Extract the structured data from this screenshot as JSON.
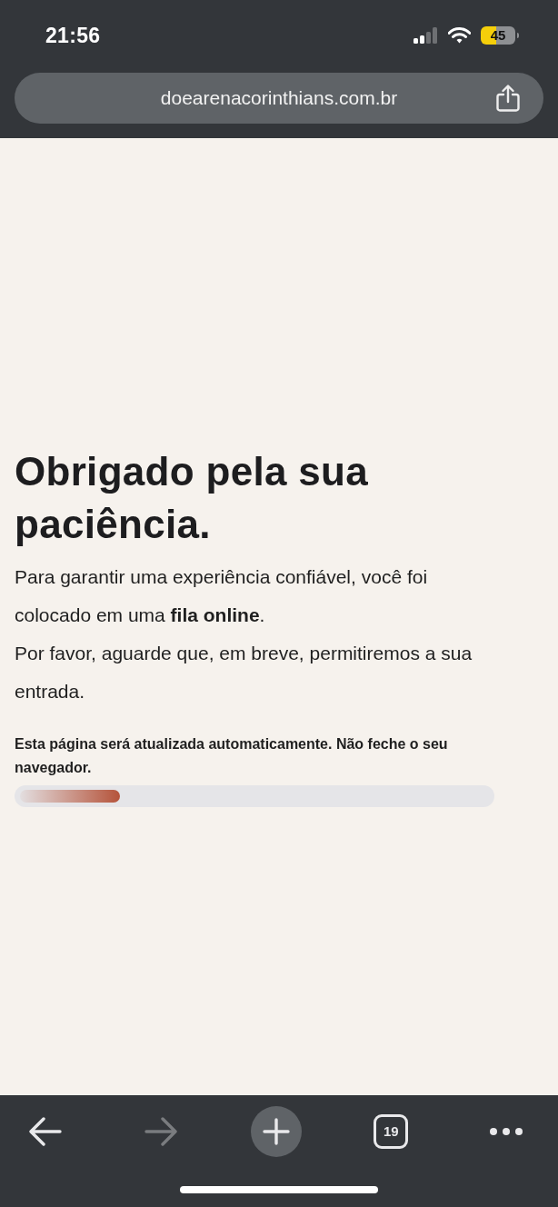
{
  "status_bar": {
    "time": "21:56",
    "battery": "45"
  },
  "address_bar": {
    "url": "doearenacorinthians.com.br"
  },
  "page": {
    "title": "Obrigado pela sua paciência.",
    "paragraphs": [
      "Para garantir uma experiência confiável, você foi colocado em uma **fila online**.",
      "Por favor, aguarde que, em breve, permitiremos a sua entrada."
    ],
    "notice": "Esta página será atualizada automaticamente. Não feche o seu navegador.",
    "progress": {
      "level": 0.22
    }
  },
  "toolbar": {
    "buttons": [
      {
        "kind": "back",
        "disabled": false
      },
      {
        "kind": "forward",
        "disabled": true
      },
      {
        "kind": "new-tab",
        "disabled": false
      },
      {
        "kind": "tabs",
        "count": "19",
        "disabled": false
      },
      {
        "kind": "more",
        "disabled": false
      }
    ]
  }
}
